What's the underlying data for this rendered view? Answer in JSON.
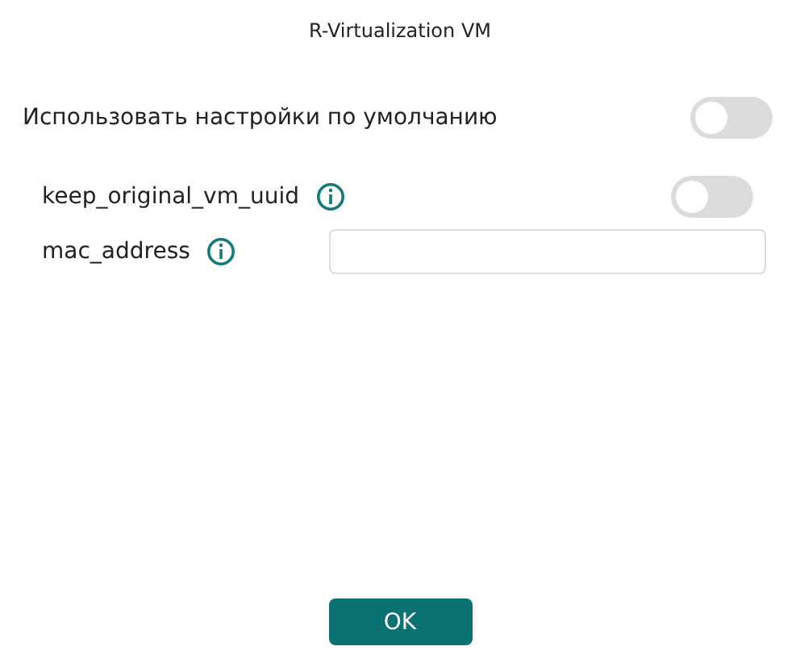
{
  "window": {
    "title": "R-Virtualization VM"
  },
  "default_setting": {
    "label": "Использовать настройки по умолчанию",
    "on": false
  },
  "fields": [
    {
      "kind": "toggle",
      "label": "keep_original_vm_uuid",
      "on": false
    },
    {
      "kind": "text",
      "label": "mac_address"
    }
  ],
  "buttons": [
    "OK"
  ]
}
